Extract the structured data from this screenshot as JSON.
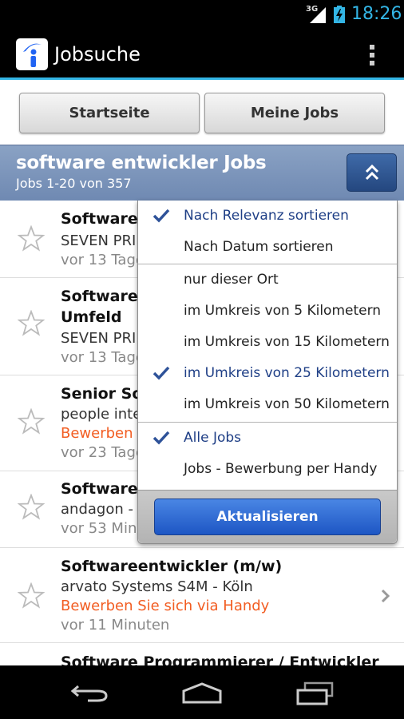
{
  "status_bar": {
    "network": "3G",
    "time": "18:26"
  },
  "app": {
    "title": "Jobsuche",
    "logo_icon": "indeed-i-logo",
    "menu_icon": "overflow-menu-icon"
  },
  "top_buttons": {
    "home": "Startseite",
    "my_jobs": "Meine Jobs"
  },
  "search": {
    "title": "software entwickler Jobs",
    "count": "Jobs 1-20 von 357"
  },
  "jobs": [
    {
      "title": "Software-",
      "company": "SEVEN PRI",
      "date": "vor 13 Tage"
    },
    {
      "title": "Software-",
      "title2": "Umfeld",
      "company": "SEVEN PRI",
      "date": "vor 13 Tage"
    },
    {
      "title": "Senior So",
      "company": "people inte",
      "apply": "Bewerben S",
      "date": "vor 23 Tage"
    },
    {
      "title": "Softwaree",
      "company": "andagon -",
      "date": "vor 53 Minut"
    },
    {
      "title": "Softwareentwickler (m/w)",
      "company": "arvato Systems S4M -  Köln",
      "apply": "Bewerben Sie sich via Handy",
      "date": "vor 11 Minuten"
    },
    {
      "title": "Software Programmierer / Entwickler"
    }
  ],
  "dropdown": {
    "sort": [
      {
        "label": "Nach Relevanz sortieren",
        "selected": true
      },
      {
        "label": "Nach Datum sortieren",
        "selected": false
      }
    ],
    "radius": [
      {
        "label": "nur dieser Ort",
        "selected": false
      },
      {
        "label": "im Umkreis von 5 Kilometern",
        "selected": false
      },
      {
        "label": "im Umkreis von 15 Kilometern",
        "selected": false
      },
      {
        "label": "im Umkreis von 25 Kilometern",
        "selected": true
      },
      {
        "label": "im Umkreis von 50 Kilometern",
        "selected": false
      }
    ],
    "filter": [
      {
        "label": "Alle Jobs",
        "selected": true
      },
      {
        "label": "Jobs - Bewerbung per Handy",
        "selected": false
      }
    ],
    "update_button": "Aktualisieren"
  },
  "colors": {
    "accent": "#33b5e5",
    "apply": "#f25d22",
    "selected": "#1f3f86",
    "header": "#7a93b9"
  }
}
